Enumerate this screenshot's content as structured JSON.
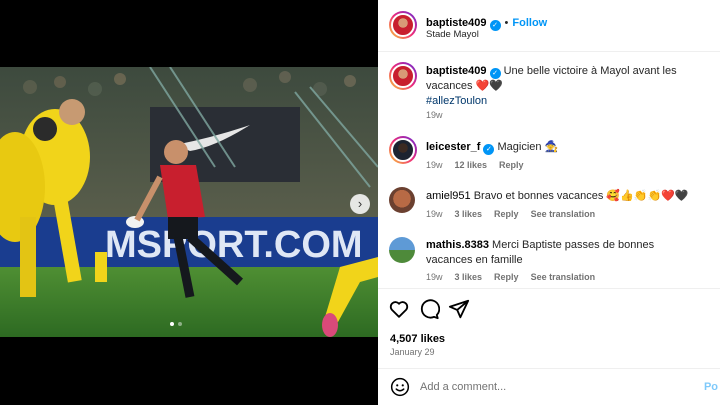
{
  "post": {
    "author": "baptiste409",
    "follow_label": "Follow",
    "location": "Stade Mayol",
    "caption": "Une belle victoire à Mayol avant les vacances ❤️🖤",
    "hashtag": "#allezToulon",
    "caption_age": "19w",
    "photo_banner_text": "MSPORT.COM",
    "carousel": {
      "current": 1,
      "total": 2
    }
  },
  "comments": [
    {
      "user": "leicester_f",
      "verified": true,
      "text": "Magicien 🧙",
      "age": "19w",
      "likes": "12 likes",
      "reply": "Reply",
      "translate": ""
    },
    {
      "user": "amiel951",
      "verified": false,
      "text": "Bravo et bonnes vacances 🥰👍👏👏❤️🖤",
      "age": "19w",
      "likes": "3 likes",
      "reply": "Reply",
      "translate": "See translation"
    },
    {
      "user": "mathis.8383",
      "verified": false,
      "text": "Merci Baptiste passes de bonnes vacances en famille",
      "age": "19w",
      "likes": "3 likes",
      "reply": "Reply",
      "translate": "See translation"
    }
  ],
  "engagement": {
    "likes": "4,507 likes",
    "date": "January 29"
  },
  "composer": {
    "placeholder": "Add a comment...",
    "post_label": "Po"
  },
  "colors": {
    "accent": "#0095f6",
    "muted": "#737373",
    "photo_grass": "#3c7a2f",
    "jersey_red": "#c81f2e",
    "jersey_yellow": "#f1d41a"
  }
}
